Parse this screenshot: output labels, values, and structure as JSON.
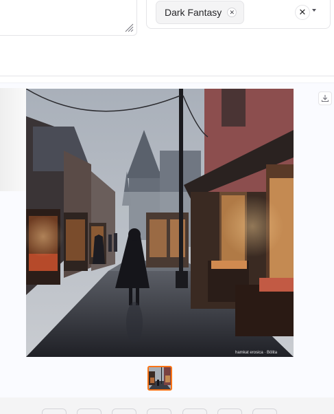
{
  "style_selector": {
    "selected_chip": "Dark Fantasy",
    "chip_remove_icon": "close-icon",
    "clear_icon": "close-icon",
    "dropdown_icon": "caret-down-icon"
  },
  "gallery": {
    "download_icon": "download-icon",
    "image_watermark": "hamkat erosica · Bölita",
    "colors": {
      "selected_thumb_border": "#f97316"
    }
  }
}
